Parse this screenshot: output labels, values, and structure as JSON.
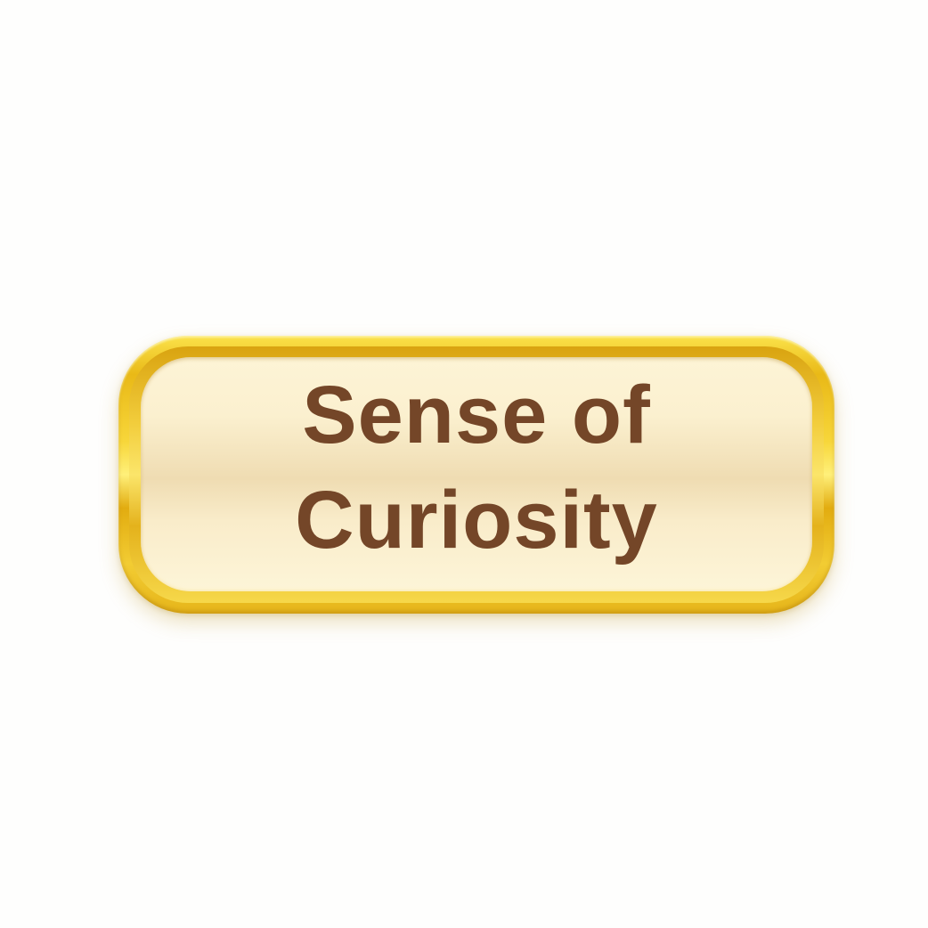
{
  "badge": {
    "line1": "Sense of",
    "line2": "Curiosity",
    "colors": {
      "text": "#744628",
      "gold": "#f2cc33",
      "cream": "#fbf0cf",
      "background": "#fefefd"
    }
  }
}
